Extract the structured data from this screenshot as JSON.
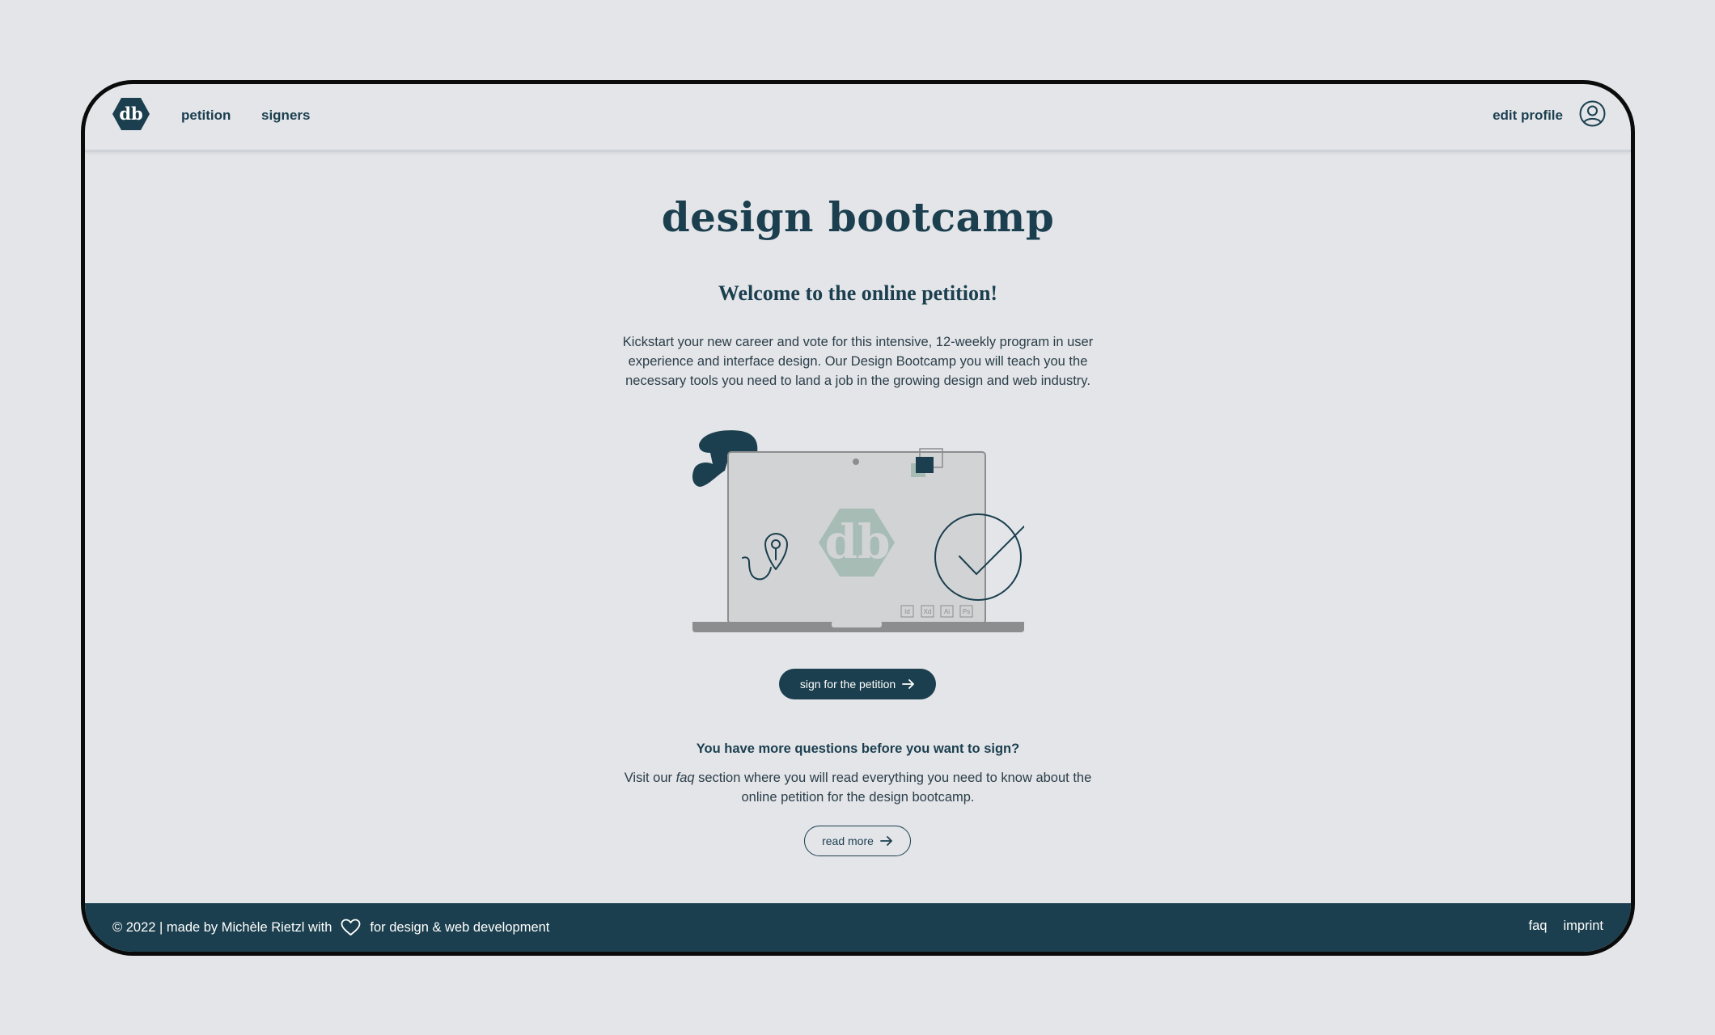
{
  "nav": {
    "logo_icon": "db-hexagon-logo-icon",
    "links": [
      "petition",
      "signers"
    ],
    "edit_profile": "edit profile",
    "user_icon": "user-circle-icon"
  },
  "hero": {
    "title": "design bootcamp",
    "welcome": "Welcome to the online petition!",
    "intro": "Kickstart your new career and vote for this intensive, 12-weekly program in user experience and interface design. Our Design Bootcamp you will teach you the necessary tools you need to land a job in the growing design and web industry.",
    "illustration_badges": [
      "Id",
      "Xd",
      "Ai",
      "Ps"
    ],
    "sign_button": "sign for the petition"
  },
  "faq": {
    "question": "You have more questions before you want to sign?",
    "text_before": "Visit our ",
    "text_em": "faq",
    "text_after": " section where you will read everything you need to know about the online petition for the design bootcamp.",
    "read_more": "read more"
  },
  "footer": {
    "left_before": "© 2022 | made by Michèle Rietzl with",
    "left_after": "for design & web development",
    "heart_icon": "heart-outline-icon",
    "links": [
      "faq",
      "imprint"
    ]
  },
  "colors": {
    "primary": "#1b3f4e",
    "background": "#e3e5e9",
    "logo_muted": "#a6bcb5"
  }
}
